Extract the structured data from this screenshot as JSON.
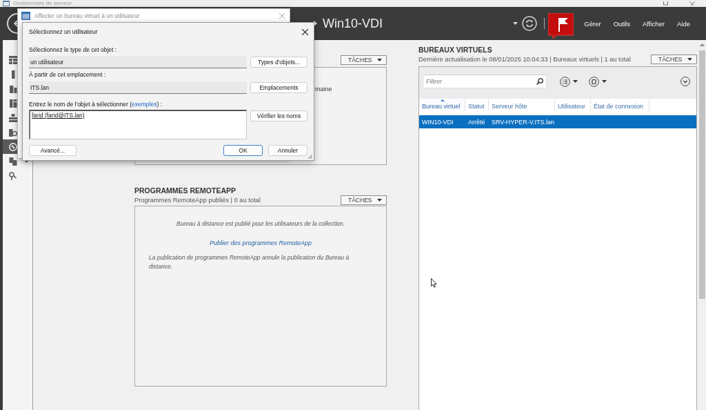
{
  "window": {
    "title": "Gestionnaire de serveur"
  },
  "header": {
    "breadcrumb": "Win10-VDI",
    "menu": [
      "Gérer",
      "Outils",
      "Afficher",
      "Aide"
    ]
  },
  "sidebar": {
    "items": [
      {
        "selected": false
      },
      {
        "selected": false
      },
      {
        "selected": false
      },
      {
        "selected": false
      },
      {
        "selected": false
      },
      {
        "selected": false
      },
      {
        "selected": true
      },
      {
        "selected": false
      },
      {
        "selected": false
      }
    ]
  },
  "upper_panel": {
    "tasks_button": "TÂCHES",
    "text_fragment": "maine"
  },
  "remoteapp_panel": {
    "title": "PROGRAMMES REMOTEAPP",
    "subtitle": "Programmes RemoteApp publiés | 0 au total",
    "tasks_button": "TÂCHES",
    "message": "Bureau à distance est publié pour les utilisateurs de la collection.",
    "link": "Publier des programmes RemoteApp",
    "note": "La publication de programmes RemoteApp annule la publication du Bureau à distance."
  },
  "virtual_desktops": {
    "title": "BUREAUX VIRTUELS",
    "subtitle": "Dernière actualisation le 08/01/2025 10:04:33 | Bureaux virtuels | 1 au total",
    "tasks_button": "TÂCHES",
    "filter": {
      "placeholder": "Filtrer"
    },
    "table": {
      "columns": [
        {
          "label": "Bureau virtuel",
          "sorted": true
        },
        {
          "label": "Statut",
          "sorted": false
        },
        {
          "label": "Serveur hôte",
          "sorted": false
        },
        {
          "label": "Utilisateur",
          "sorted": false
        },
        {
          "label": "État de connexion",
          "sorted": false
        }
      ],
      "rows": [
        {
          "selected": true,
          "cells": [
            "WIN10-VDI",
            "Arrêté",
            "SRV-HYPER-V.ITS.lan"
          ]
        }
      ]
    }
  },
  "background_dialog": {
    "title": "Affecter un bureau virtuel à un utilisateur"
  },
  "select_user_dialog": {
    "title": "Sélectionnez un utilisateur",
    "fields": [
      {
        "label": "Sélectionnez le type de cet objet :",
        "value": "un utilisateur",
        "button": "Types d'objets..."
      },
      {
        "label": "À partir de cet emplacement :",
        "value": "ITS.lan",
        "button": "Emplacements"
      }
    ],
    "name_entry": {
      "label_start": "Entrez le nom de l'objet à sélectionner (",
      "link": "exemples",
      "label_end": ") :",
      "value": "farid (farid@ITS.lan)",
      "button": "Vérifier les noms"
    },
    "buttons": [
      {
        "label": "Avancé...",
        "default": false
      },
      {
        "label": "OK",
        "default": true
      },
      {
        "label": "Annuler",
        "default": false
      }
    ]
  }
}
